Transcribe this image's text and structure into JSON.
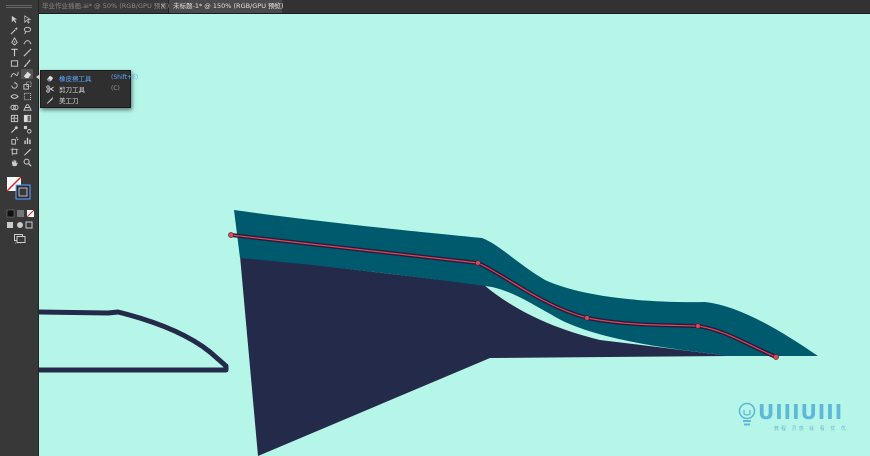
{
  "tabs": [
    {
      "label": "毕业作业插画.ai* @ 50% (RGB/GPU 预览)",
      "close": "×"
    },
    {
      "label": "未标题-1* @ 150% (RGB/GPU 预览)",
      "close": "×"
    }
  ],
  "flyout": {
    "items": [
      {
        "label": "橡皮擦工具",
        "shortcut": "(Shift+E)",
        "icon": "eraser-icon"
      },
      {
        "label": "剪刀工具",
        "shortcut": "(C)",
        "icon": "scissors-icon"
      },
      {
        "label": "美工刀",
        "shortcut": "",
        "icon": "knife-icon"
      }
    ]
  },
  "toolbar": {
    "more_label": "···",
    "tools": [
      "selection-tool",
      "direct-selection-tool",
      "magic-wand-tool",
      "lasso-tool",
      "pen-tool",
      "curvature-tool",
      "type-tool",
      "line-tool",
      "rectangle-tool",
      "paintbrush-tool",
      "shaper-tool",
      "eraser-tool",
      "rotate-tool",
      "scale-tool",
      "width-tool",
      "free-transform-tool",
      "shape-builder-tool",
      "perspective-grid-tool",
      "mesh-tool",
      "gradient-tool",
      "eyedropper-tool",
      "blend-tool",
      "symbol-sprayer-tool",
      "column-graph-tool",
      "artboard-tool",
      "slice-tool",
      "hand-tool",
      "zoom-tool"
    ]
  },
  "colors": {
    "canvas": "#b6f6e8",
    "shape_top": "#005a6e",
    "shape_bottom": "#242b4a",
    "path_stroke": "#d94a5a",
    "accent": "#5aa9ff"
  },
  "watermark": {
    "logo_text": "UIIIUIII",
    "sub_text": "教程 灵感 就 看 优 优"
  }
}
